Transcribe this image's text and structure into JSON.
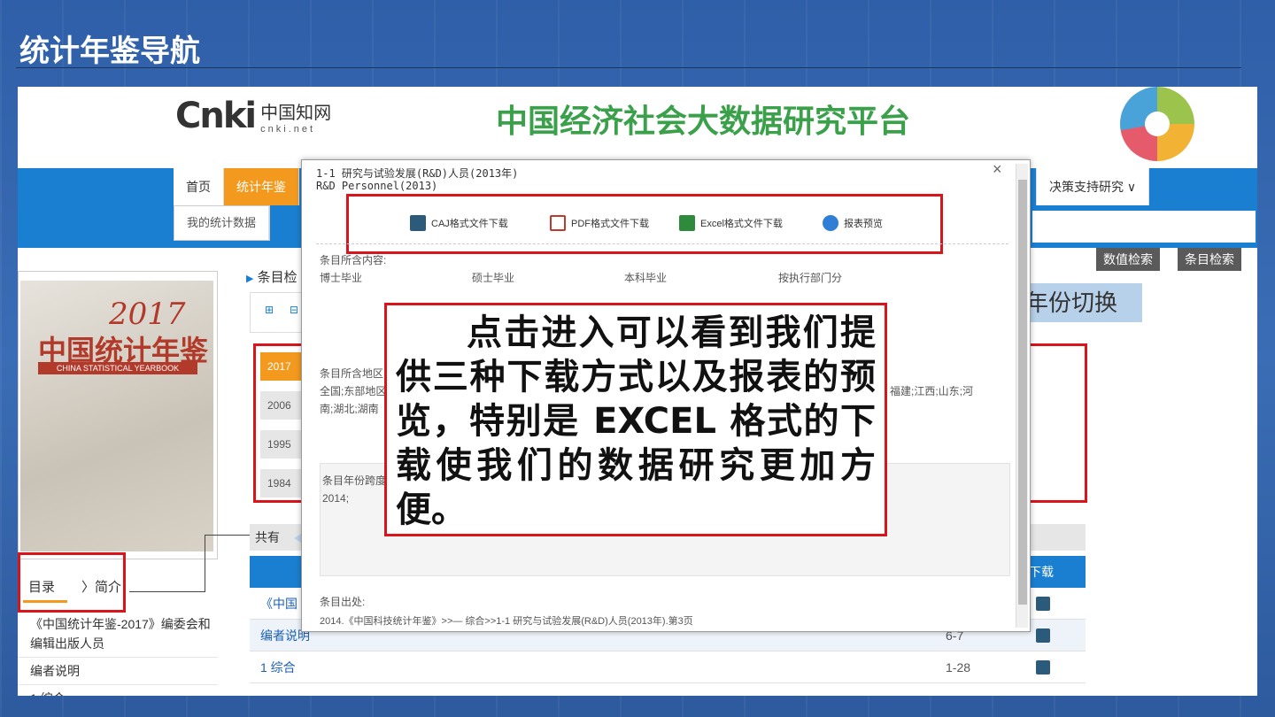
{
  "slide": {
    "title": "统计年鉴导航"
  },
  "site": {
    "logo_mark": "Cnki",
    "logo_cn": "中国知网",
    "logo_en": "cnki.net",
    "platform_title": "中国经济社会大数据研究平台"
  },
  "nav": {
    "home": "首页",
    "yearbook": "统计年鉴",
    "decision": "决策支持研究",
    "my_data": "我的统计数据"
  },
  "search_buttons": {
    "numeric": "数值检索",
    "entry": "条目检索"
  },
  "book": {
    "year": "2017",
    "title": "中国统计年鉴",
    "title_en": "CHINA STATISTICAL YEARBOOK"
  },
  "left_tabs": {
    "catalog": "目录",
    "intro": "〉简介"
  },
  "toc": [
    "《中国统计年鉴-2017》编委会和编辑出版人员",
    "编者说明",
    "1 综合"
  ],
  "breadcrumb": "条目检",
  "years": [
    "2017",
    "2006",
    "1995",
    "1984"
  ],
  "year_switch": "年份切换",
  "table": {
    "total_prefix": "共有",
    "download_header": "下载",
    "rows": [
      {
        "name": "《中国",
        "pages": ""
      },
      {
        "name": "编者说明",
        "pages": "6-7"
      },
      {
        "name": "1 综合",
        "pages": "1-28"
      }
    ]
  },
  "modal": {
    "title_cn": "1-1 研究与试验发展(R&D)人员(2013年)",
    "title_en": "R&D Personnel(2013)",
    "close": "×",
    "downloads": {
      "caj": "CAJ格式文件下载",
      "pdf": "PDF格式文件下载",
      "excel": "Excel格式文件下载",
      "preview": "报表预览"
    },
    "content_label": "条目所含内容:",
    "content_values": [
      "博士毕业",
      "硕士毕业",
      "本科毕业",
      "按执行部门分"
    ],
    "region_label": "条目所含地区",
    "region_line1_start": "全国;东部地区",
    "region_line1_end": "福建;江西;山东;河",
    "region_line2": "南;湖北;湖南",
    "span_label": "条目年份跨度",
    "span_value": "2014;",
    "source_label": "条目出处:",
    "source_value": "2014.《中国科技统计年鉴》>>— 综合>>1-1 研究与试验发展(R&D)人员(2013年).第3页"
  },
  "callout": "点击进入可以看到我们提供三种下载方式以及报表的预览，特别是 EXCEL 格式的下载使我们的数据研究更加方便。",
  "colors": {
    "accent_orange": "#f39a1e",
    "nav_blue": "#1b7fd1",
    "highlight_red": "#d7151a",
    "platform_green": "#3aa04a"
  }
}
